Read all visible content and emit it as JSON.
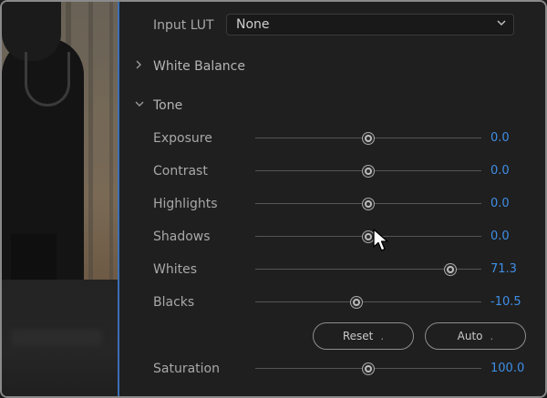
{
  "input_lut": {
    "label": "Input LUT",
    "value": "None"
  },
  "sections": {
    "white_balance": {
      "label": "White Balance",
      "expanded": false
    },
    "tone": {
      "label": "Tone",
      "expanded": true
    }
  },
  "sliders": [
    {
      "key": "exposure",
      "label": "Exposure",
      "value": "0.0",
      "position": 0.5
    },
    {
      "key": "contrast",
      "label": "Contrast",
      "value": "0.0",
      "position": 0.5
    },
    {
      "key": "highlights",
      "label": "Highlights",
      "value": "0.0",
      "position": 0.5
    },
    {
      "key": "shadows",
      "label": "Shadows",
      "value": "0.0",
      "position": 0.5
    },
    {
      "key": "whites",
      "label": "Whites",
      "value": "71.3",
      "position": 0.863
    },
    {
      "key": "blacks",
      "label": "Blacks",
      "value": "-10.5",
      "position": 0.448
    }
  ],
  "buttons": {
    "reset": "Reset",
    "auto": "Auto"
  },
  "saturation": {
    "label": "Saturation",
    "value": "100.0",
    "position": 0.5
  },
  "colors": {
    "accent": "#3f8ee6",
    "divider": "#3d6fb3"
  }
}
